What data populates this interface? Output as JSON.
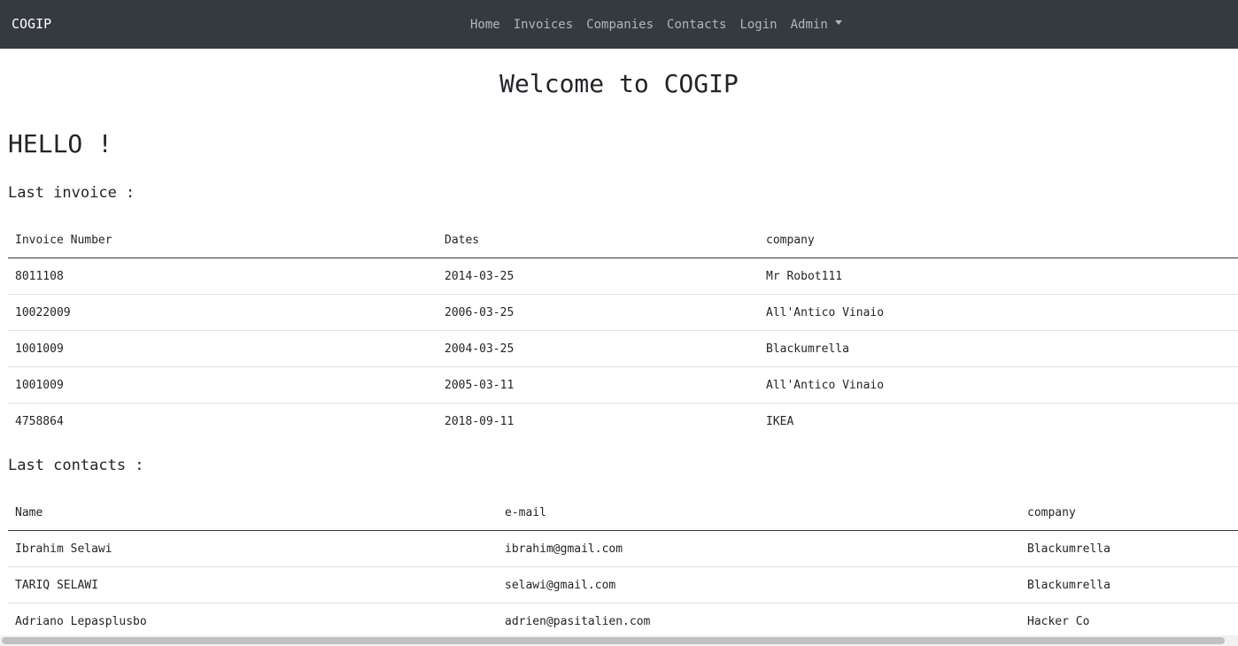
{
  "navbar": {
    "brand": "COGIP",
    "links": [
      {
        "label": "Home"
      },
      {
        "label": "Invoices"
      },
      {
        "label": "Companies"
      },
      {
        "label": "Contacts"
      },
      {
        "label": "Login"
      },
      {
        "label": "Admin"
      }
    ],
    "background": "#343a40"
  },
  "main": {
    "title": "Welcome to COGIP",
    "greeting": "HELLO !",
    "invoices": {
      "title": "Last invoice :",
      "headers": [
        "Invoice Number",
        "Dates",
        "company"
      ],
      "rows": [
        [
          "8011108",
          "2014-03-25",
          "Mr Robot111"
        ],
        [
          "10022009",
          "2006-03-25",
          "All'Antico Vinaio"
        ],
        [
          "1001009",
          "2004-03-25",
          "Blackumrella"
        ],
        [
          "1001009",
          "2005-03-11",
          "All'Antico Vinaio"
        ],
        [
          "4758864",
          "2018-09-11",
          "IKEA"
        ]
      ]
    },
    "contacts": {
      "title": "Last contacts :",
      "headers": [
        "Name",
        "e-mail",
        "company"
      ],
      "rows": [
        [
          "Ibrahim Selawi",
          "ibrahim@gmail.com",
          "Blackumrella"
        ],
        [
          "TARIQ SELAWI",
          "selawi@gmail.com",
          "Blackumrella"
        ],
        [
          "Adriano Lepasplusbo",
          "adrien@pasitalien.com",
          "Hacker Co"
        ]
      ]
    }
  },
  "icons": {
    "admin_dropdown": "caret-down-icon"
  }
}
